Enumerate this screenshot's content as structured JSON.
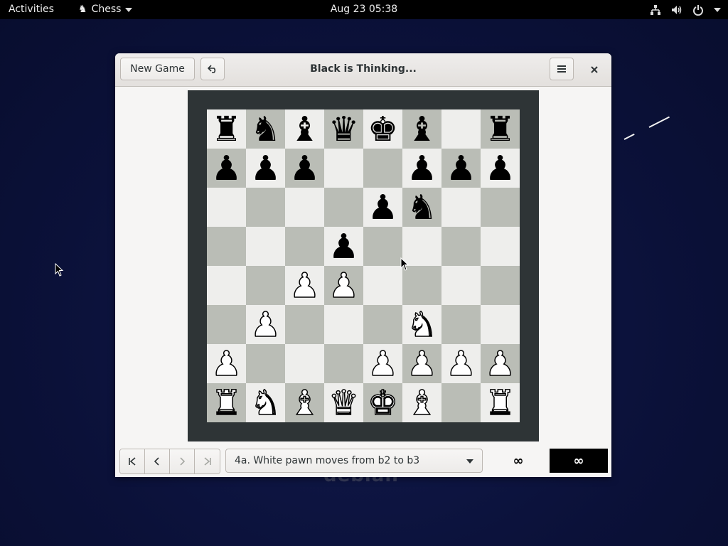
{
  "topbar": {
    "activities": "Activities",
    "app_name": "Chess",
    "clock": "Aug 23  05:38",
    "tray_icons": [
      "network-icon",
      "volume-icon",
      "power-icon"
    ]
  },
  "window": {
    "title": "Black is Thinking...",
    "new_game_label": "New Game",
    "undo_icon": "undo-icon",
    "menu_icon": "hamburger-menu-icon",
    "close_icon": "close-icon"
  },
  "board": {
    "ranks": [
      [
        "r",
        "n",
        "b",
        "q",
        "k",
        "b",
        "",
        "r"
      ],
      [
        "p",
        "p",
        "p",
        "",
        "",
        "p",
        "p",
        "p"
      ],
      [
        "",
        "",
        "",
        "",
        "p",
        "n",
        "",
        ""
      ],
      [
        "",
        "",
        "",
        "p",
        "",
        "",
        "",
        ""
      ],
      [
        "",
        "",
        "P",
        "P",
        "",
        "",
        "",
        ""
      ],
      [
        "",
        "P",
        "",
        "",
        "",
        "N",
        "",
        ""
      ],
      [
        "P",
        "",
        "",
        "",
        "P",
        "P",
        "P",
        "P"
      ],
      [
        "R",
        "N",
        "B",
        "Q",
        "K",
        "B",
        "",
        "R"
      ]
    ]
  },
  "bottombar": {
    "nav_buttons": [
      "first-move-icon",
      "previous-move-icon",
      "next-move-icon",
      "last-move-icon"
    ],
    "move_text": "4a. White pawn moves from b2 to b3",
    "white_clock": "∞",
    "black_clock": "∞"
  },
  "colors": {
    "light_square": "#eeeeec",
    "dark_square": "#babdb6",
    "board_frame": "#2e3436",
    "desktop": "#0d1340"
  }
}
